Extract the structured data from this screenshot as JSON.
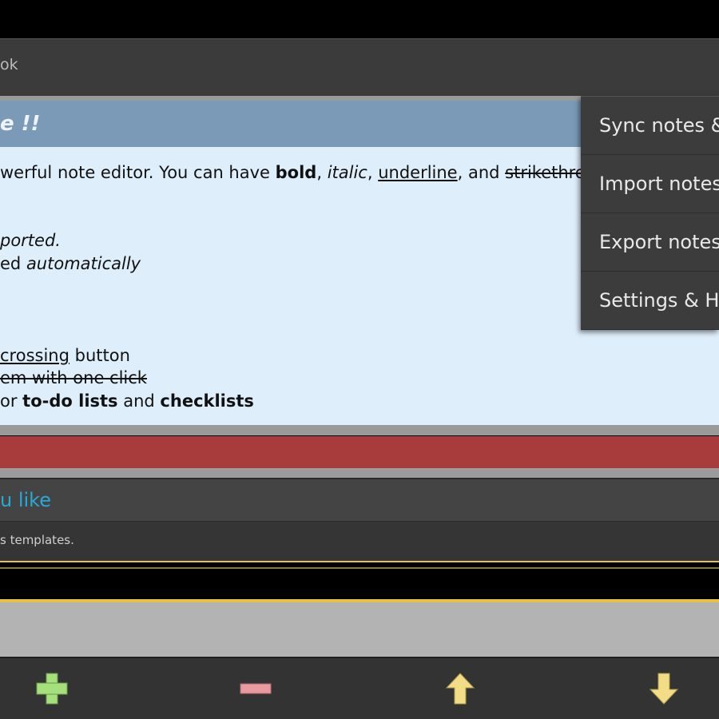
{
  "app": {
    "title_fragment": "ok"
  },
  "note": {
    "title": "e !!",
    "lines": [
      {
        "a": "werful note editor. You can have ",
        "bold": "bold",
        "b": ", ",
        "italic": "italic",
        "c": ", ",
        "underline": "underline",
        "d": ", and ",
        "strike": "strikethro"
      },
      {
        "italic": "ported."
      },
      {
        "a": "ed ",
        "italic": "automatically"
      },
      {
        "underline": " crossing",
        "a": " button"
      },
      {
        "strike": "em with one click"
      },
      {
        "a": "or ",
        "bold1": "to-do lists",
        "b": " and ",
        "bold2": "checklists"
      }
    ]
  },
  "second_card": {
    "title": "u like",
    "description": "s templates."
  },
  "menu": {
    "items": [
      "Sync notes &",
      "Import notes",
      "Export notes",
      "Settings & He"
    ]
  },
  "toolbar": {
    "buttons": [
      {
        "name": "add",
        "icon": "plus-icon",
        "color": "#a6e07c"
      },
      {
        "name": "remove",
        "icon": "minus-icon",
        "color": "#e99aa0"
      },
      {
        "name": "move-up",
        "icon": "arrow-up-icon",
        "color": "#f3dc86"
      },
      {
        "name": "move-down",
        "icon": "arrow-down-icon",
        "color": "#f3dc86"
      }
    ]
  },
  "colors": {
    "note_header": "#7b9ab8",
    "note_body": "#dfeefb",
    "red_bar": "#a83c3c",
    "link_blue": "#29a9d6"
  }
}
